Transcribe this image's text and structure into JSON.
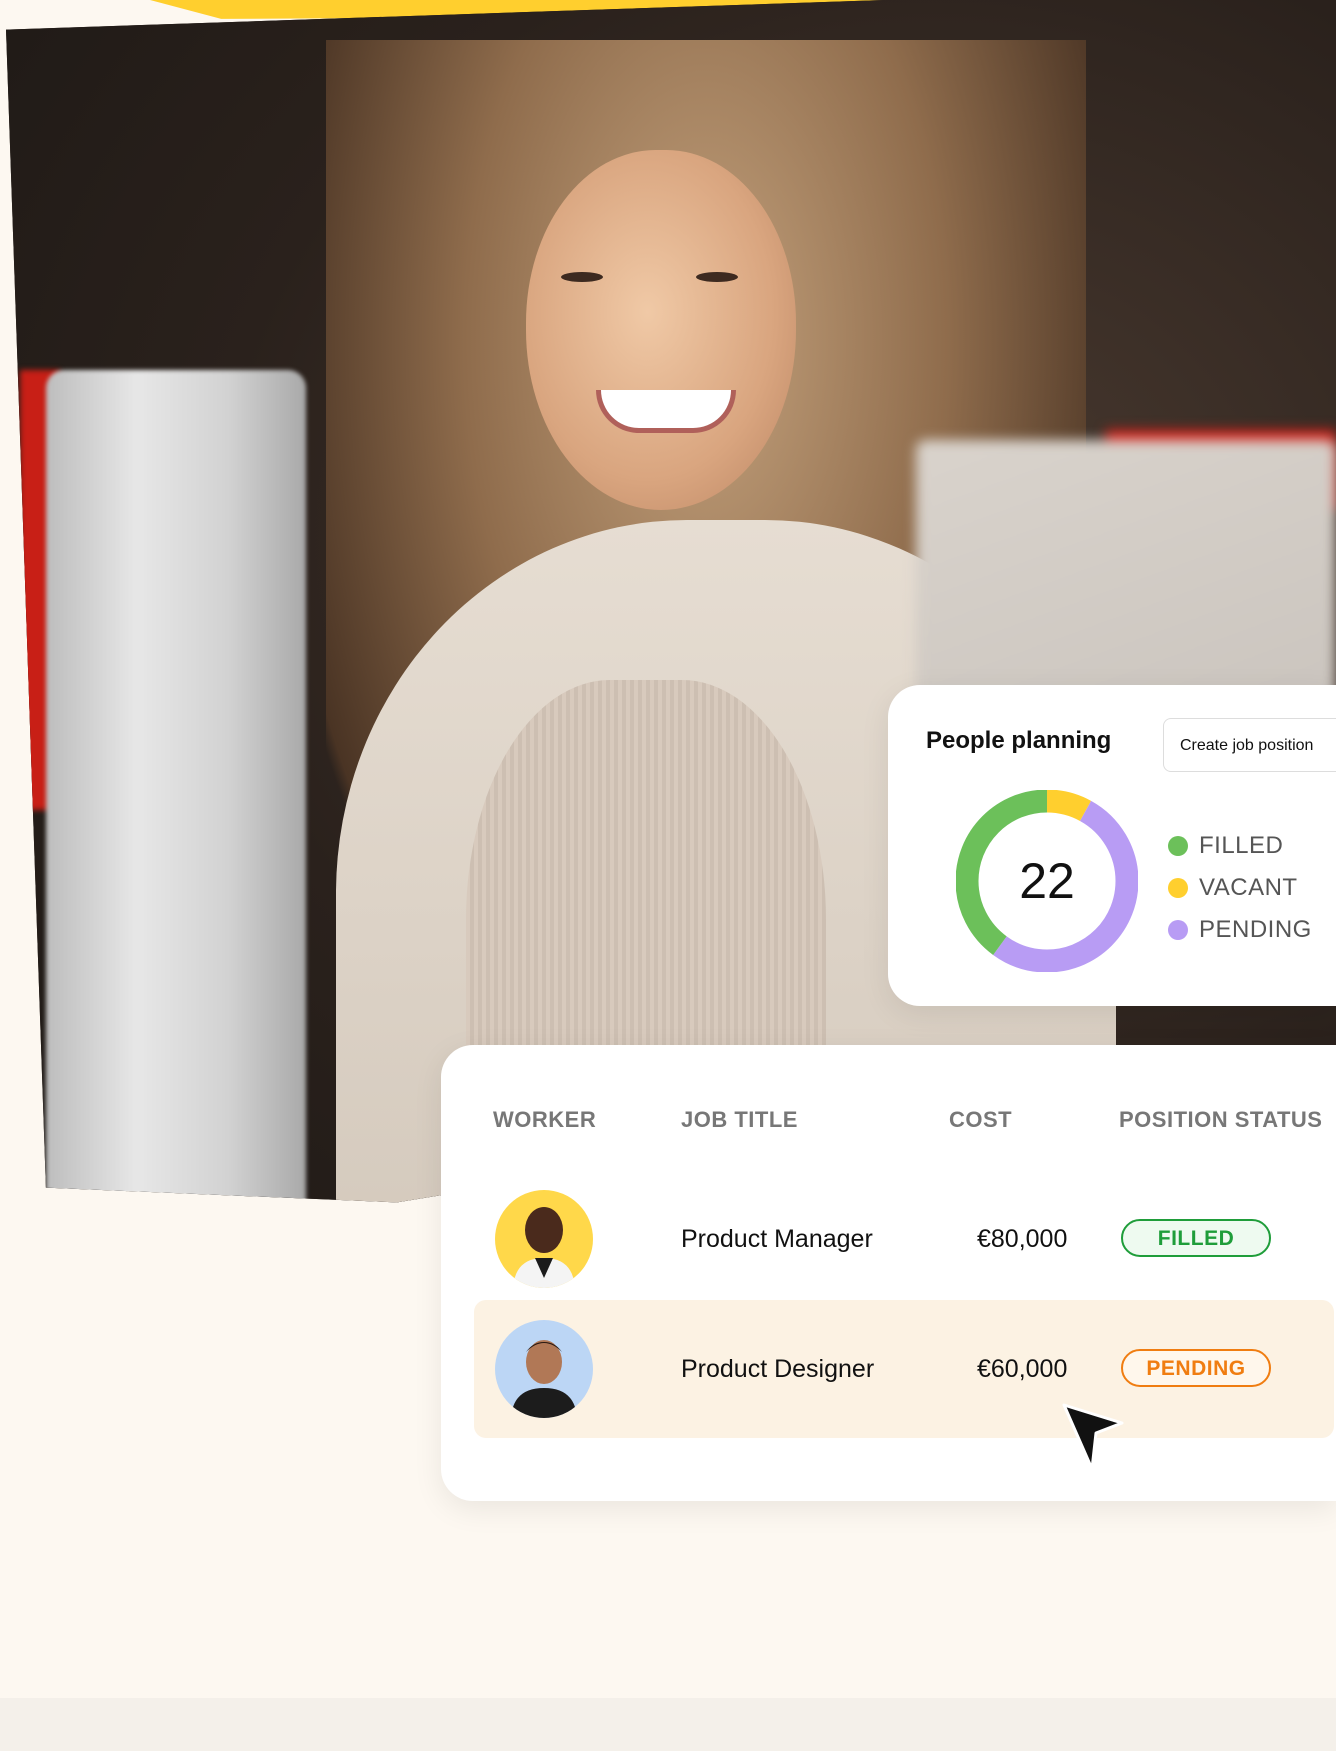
{
  "planning": {
    "title": "People planning",
    "create_button": "Create job position",
    "total": "22",
    "donut_segments": [
      {
        "label": "FILLED",
        "fraction": 0.4,
        "color": "#6cc05a"
      },
      {
        "label": "VACANT",
        "fraction": 0.08,
        "color": "#ffcf2e"
      },
      {
        "label": "PENDING",
        "fraction": 0.52,
        "color": "#b89cf4"
      }
    ],
    "legend": [
      {
        "label": "FILLED",
        "color": "#6cc05a"
      },
      {
        "label": "VACANT",
        "color": "#ffcf2e"
      },
      {
        "label": "PENDING",
        "color": "#b89cf4"
      }
    ]
  },
  "table": {
    "headers": {
      "worker": "WORKER",
      "job_title": "JOB TITLE",
      "cost": "COST",
      "position_status": "POSITION STATUS"
    },
    "rows": [
      {
        "job_title": "Product Manager",
        "cost": "€80,000",
        "status": "FILLED",
        "avatar_bg": "#ffd84a"
      },
      {
        "job_title": "Product Designer",
        "cost": "€60,000",
        "status": "PENDING",
        "avatar_bg": "#bcd6f5"
      }
    ]
  },
  "colors": {
    "accent_yellow": "#ffcf2e",
    "page_bg": "#fdf8f1",
    "filled_green": "#1f9d3a",
    "pending_orange": "#f07d11"
  }
}
